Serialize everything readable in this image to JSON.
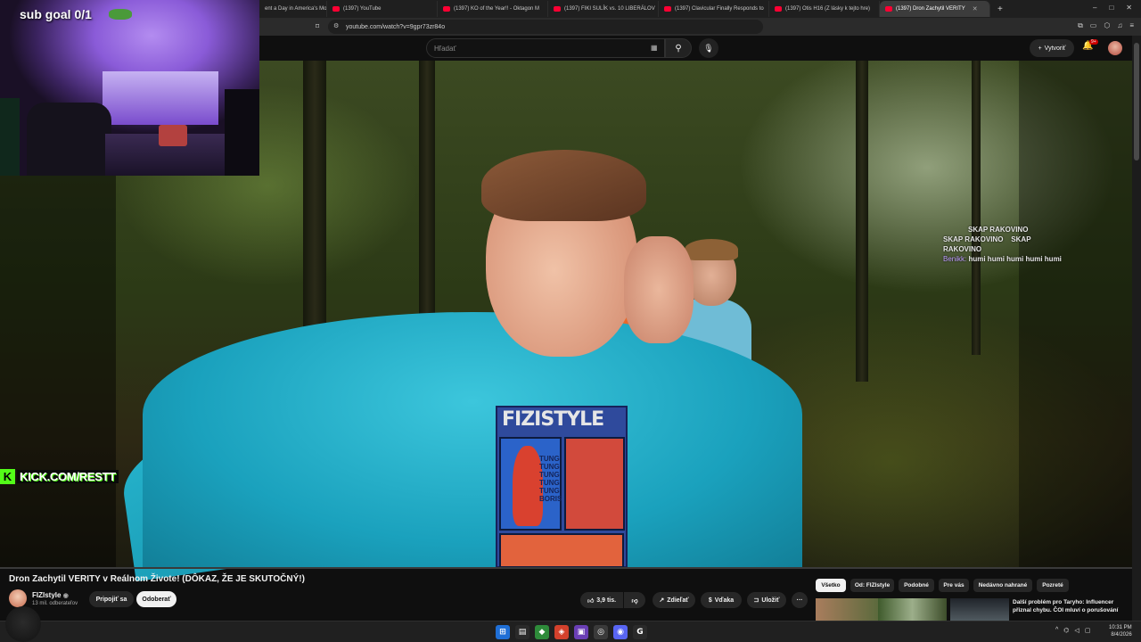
{
  "browser": {
    "tabs": [
      {
        "label": "ent a Day in America's Mo"
      },
      {
        "label": "(1397) YouTube"
      },
      {
        "label": "(1397) KO of the Year!! - Oktagon M"
      },
      {
        "label": "(1397) FIKI SULÍK vs. 10 LIBERÁLOV"
      },
      {
        "label": "(1397) Clavicular Finally Responds to"
      },
      {
        "label": "(1397) Otis H16 (Z lásky k tejto hre)"
      },
      {
        "label": "(1397) Dron Zachytil VERITY"
      }
    ],
    "new_tab": "+",
    "window_controls": [
      "–",
      "□",
      "✕"
    ],
    "url": "youtube.com/watch?v=9gpr73zr84o"
  },
  "youtube_header": {
    "search_placeholder": "Hľadať",
    "create_label": "Vytvoriť",
    "notifications_badge": "9+"
  },
  "overlay": {
    "sub_goal": "sub goal 0/1",
    "kick_k": "K",
    "kick_url": "KICK.COM/RESTT",
    "chat": [
      {
        "user": "",
        "text": "SKAP RAKOVINO"
      },
      {
        "user": "",
        "text": "SKAP RAKOVINO    SKAP"
      },
      {
        "user": "",
        "text": "RAKOVINO"
      },
      {
        "user": "Benikk:",
        "text": "humi humi humi humi humi"
      }
    ]
  },
  "video_art": {
    "shirt_print": "FIZISTYLE",
    "tung_lines": [
      "TUNG",
      "TUNG",
      "TUNG",
      "TUNG",
      "TUNG",
      "BORIS"
    ]
  },
  "video": {
    "title": "Dron Zachytil VERITY v Reálnom Živote! (DÔKAZ, ŽE JE SKUTOČNÝ!)",
    "channel_name": "FIZIstyle",
    "subscribers": "13 mil. odberateľov",
    "join_label": "Pripojiť sa",
    "unsubscribe_label": "Odoberať",
    "likes": "3,9 tis.",
    "share_label": "Zdieľať",
    "thanks_label": "Vďaka",
    "save_label": "Uložiť",
    "more_label": "···"
  },
  "recommendations": {
    "chips": [
      "Všetko",
      "Od: FIZIstyle",
      "Podobné",
      "Pre vás",
      "Nedávno nahrané",
      "Pozreté"
    ],
    "first_title": "Další problém pro Taryho: Influencer přiznal chybu. ČOI mluví o porušování"
  },
  "taskbar": {
    "time": "10:31 PM",
    "date": "8/4/2026"
  },
  "colors": {
    "youtube_red": "#ff0033",
    "kick_green": "#53fc18",
    "hoodie": "#1aa1bd"
  }
}
